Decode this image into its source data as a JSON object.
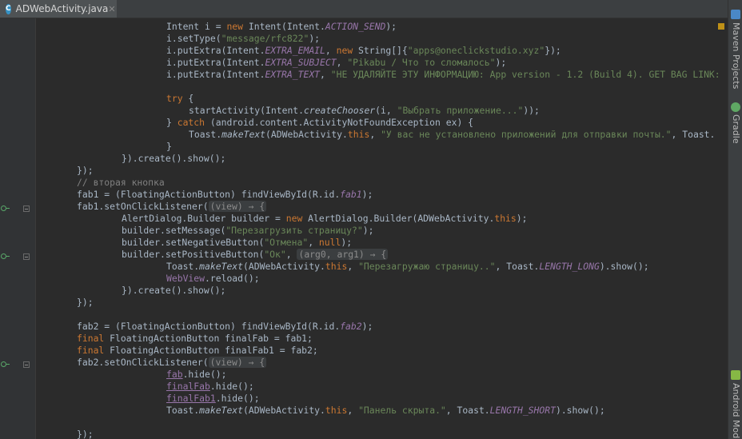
{
  "tab": {
    "title": "ADWebActivity.java",
    "icon_letter": "C"
  },
  "right_sidebar": {
    "maven": "Maven Projects",
    "gradle": "Gradle",
    "android": "Android Mod"
  },
  "colors": {
    "background": "#2b2b2b",
    "keyword": "#cc7832",
    "string": "#6a8759",
    "field": "#9876aa",
    "comment": "#808080",
    "text": "#a9b7c6"
  },
  "code": {
    "l1": {
      "a": "Intent i = ",
      "b": "new",
      "c": " Intent(Intent.",
      "d": "ACTION_SEND",
      "e": ");"
    },
    "l2": {
      "a": "i.setType(",
      "b": "\"message/rfc822\"",
      "c": ");"
    },
    "l3": {
      "a": "i.putExtra(Intent.",
      "b": "EXTRA_EMAIL",
      "c": ", ",
      "d": "new",
      "e": " String[]{",
      "f": "\"apps@oneclickstudio.xyz\"",
      "g": "});"
    },
    "l4": {
      "a": "i.putExtra(Intent.",
      "b": "EXTRA_SUBJECT",
      "c": ", ",
      "d": "\"Pikabu / Что то сломалось\"",
      "e": ");"
    },
    "l5": {
      "a": "i.putExtra(Intent.",
      "b": "EXTRA_TEXT",
      "c": ", ",
      "d": "\"НЕ УДАЛЯЙТЕ ЭТУ ИНФОРМАЦИЮ: App version - 1.2 (Build 4). GET BAG LINK:"
    },
    "l6": {
      "a": "try",
      "b": " {"
    },
    "l7": {
      "a": "startActivity(Intent.",
      "b": "createChooser",
      "c": "(i, ",
      "d": "\"Выбрать приложение...\"",
      "e": "));"
    },
    "l8": {
      "a": "} ",
      "b": "catch",
      "c": " (android.content.ActivityNotFoundException ex) {"
    },
    "l9": {
      "a": "Toast.",
      "b": "makeText",
      "c": "(ADWebActivity.",
      "d": "this",
      "e": ", ",
      "f": "\"У вас не установлено приложений для отправки почты.\"",
      "g": ", Toast."
    },
    "l10": "}",
    "l11": "}).create().show();",
    "l12": "});",
    "l13": "// вторая кнопка",
    "l14": {
      "a": "fab1 = (FloatingActionButton) findViewById(R.id.",
      "b": "fab1",
      "c": ");"
    },
    "l15": {
      "a": "fab1.setOnClickListener(",
      "b": "(view) → {"
    },
    "l16": {
      "a": "AlertDialog.Builder builder = ",
      "b": "new",
      "c": " AlertDialog.Builder(ADWebActivity.",
      "d": "this",
      "e": ");"
    },
    "l17": {
      "a": "builder.setMessage(",
      "b": "\"Перезагрузить страницу?\"",
      "c": ");"
    },
    "l18": {
      "a": "builder.setNegativeButton(",
      "b": "\"Отмена\"",
      "c": ", ",
      "d": "null",
      "e": ");"
    },
    "l19": {
      "a": "builder.setPositiveButton(",
      "b": "\"Ок\"",
      "c": ", ",
      "d": "(arg0, arg1) → {"
    },
    "l20": {
      "a": "Toast.",
      "b": "makeText",
      "c": "(ADWebActivity.",
      "d": "this",
      "e": ", ",
      "f": "\"Перезагружаю страницу..\"",
      "g": ", Toast.",
      "h": "LENGTH_LONG",
      "i": ").show();"
    },
    "l21": {
      "a": "WebView",
      "b": ".reload();"
    },
    "l22": "}).create().show();",
    "l23": "});",
    "l24": {
      "a": "fab2 = (FloatingActionButton) findViewById(R.id.",
      "b": "fab2",
      "c": ");"
    },
    "l25": {
      "a": "final",
      "b": " FloatingActionButton finalFab = fab1;"
    },
    "l26": {
      "a": "final",
      "b": " FloatingActionButton finalFab1 = fab2;"
    },
    "l27": {
      "a": "fab2.setOnClickListener(",
      "b": "(view) → {"
    },
    "l28": {
      "a": "fab",
      "b": ".hide();"
    },
    "l29": {
      "a": "finalFab",
      "b": ".hide();"
    },
    "l30": {
      "a": "finalFab1",
      "b": ".hide();"
    },
    "l31": {
      "a": "Toast.",
      "b": "makeText",
      "c": "(ADWebActivity.",
      "d": "this",
      "e": ", ",
      "f": "\"Панель скрыта.\"",
      "g": ", Toast.",
      "h": "LENGTH_SHORT",
      "i": ").show();"
    },
    "l32": "});"
  }
}
